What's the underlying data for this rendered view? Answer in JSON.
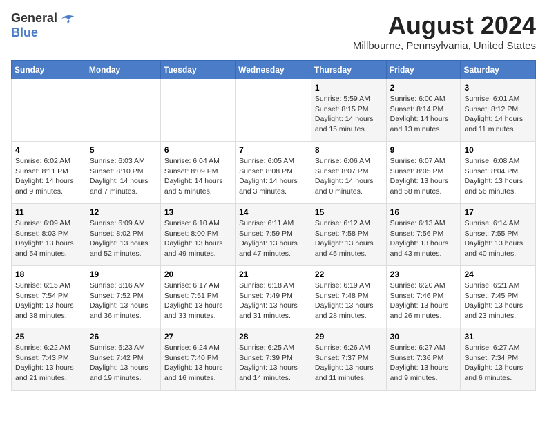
{
  "logo": {
    "line1": "General",
    "line2": "Blue"
  },
  "title": "August 2024",
  "location": "Millbourne, Pennsylvania, United States",
  "headers": [
    "Sunday",
    "Monday",
    "Tuesday",
    "Wednesday",
    "Thursday",
    "Friday",
    "Saturday"
  ],
  "weeks": [
    [
      {
        "day": "",
        "sunrise": "",
        "sunset": "",
        "daylight": ""
      },
      {
        "day": "",
        "sunrise": "",
        "sunset": "",
        "daylight": ""
      },
      {
        "day": "",
        "sunrise": "",
        "sunset": "",
        "daylight": ""
      },
      {
        "day": "",
        "sunrise": "",
        "sunset": "",
        "daylight": ""
      },
      {
        "day": "1",
        "sunrise": "Sunrise: 5:59 AM",
        "sunset": "Sunset: 8:15 PM",
        "daylight": "Daylight: 14 hours and 15 minutes."
      },
      {
        "day": "2",
        "sunrise": "Sunrise: 6:00 AM",
        "sunset": "Sunset: 8:14 PM",
        "daylight": "Daylight: 14 hours and 13 minutes."
      },
      {
        "day": "3",
        "sunrise": "Sunrise: 6:01 AM",
        "sunset": "Sunset: 8:12 PM",
        "daylight": "Daylight: 14 hours and 11 minutes."
      }
    ],
    [
      {
        "day": "4",
        "sunrise": "Sunrise: 6:02 AM",
        "sunset": "Sunset: 8:11 PM",
        "daylight": "Daylight: 14 hours and 9 minutes."
      },
      {
        "day": "5",
        "sunrise": "Sunrise: 6:03 AM",
        "sunset": "Sunset: 8:10 PM",
        "daylight": "Daylight: 14 hours and 7 minutes."
      },
      {
        "day": "6",
        "sunrise": "Sunrise: 6:04 AM",
        "sunset": "Sunset: 8:09 PM",
        "daylight": "Daylight: 14 hours and 5 minutes."
      },
      {
        "day": "7",
        "sunrise": "Sunrise: 6:05 AM",
        "sunset": "Sunset: 8:08 PM",
        "daylight": "Daylight: 14 hours and 3 minutes."
      },
      {
        "day": "8",
        "sunrise": "Sunrise: 6:06 AM",
        "sunset": "Sunset: 8:07 PM",
        "daylight": "Daylight: 14 hours and 0 minutes."
      },
      {
        "day": "9",
        "sunrise": "Sunrise: 6:07 AM",
        "sunset": "Sunset: 8:05 PM",
        "daylight": "Daylight: 13 hours and 58 minutes."
      },
      {
        "day": "10",
        "sunrise": "Sunrise: 6:08 AM",
        "sunset": "Sunset: 8:04 PM",
        "daylight": "Daylight: 13 hours and 56 minutes."
      }
    ],
    [
      {
        "day": "11",
        "sunrise": "Sunrise: 6:09 AM",
        "sunset": "Sunset: 8:03 PM",
        "daylight": "Daylight: 13 hours and 54 minutes."
      },
      {
        "day": "12",
        "sunrise": "Sunrise: 6:09 AM",
        "sunset": "Sunset: 8:02 PM",
        "daylight": "Daylight: 13 hours and 52 minutes."
      },
      {
        "day": "13",
        "sunrise": "Sunrise: 6:10 AM",
        "sunset": "Sunset: 8:00 PM",
        "daylight": "Daylight: 13 hours and 49 minutes."
      },
      {
        "day": "14",
        "sunrise": "Sunrise: 6:11 AM",
        "sunset": "Sunset: 7:59 PM",
        "daylight": "Daylight: 13 hours and 47 minutes."
      },
      {
        "day": "15",
        "sunrise": "Sunrise: 6:12 AM",
        "sunset": "Sunset: 7:58 PM",
        "daylight": "Daylight: 13 hours and 45 minutes."
      },
      {
        "day": "16",
        "sunrise": "Sunrise: 6:13 AM",
        "sunset": "Sunset: 7:56 PM",
        "daylight": "Daylight: 13 hours and 43 minutes."
      },
      {
        "day": "17",
        "sunrise": "Sunrise: 6:14 AM",
        "sunset": "Sunset: 7:55 PM",
        "daylight": "Daylight: 13 hours and 40 minutes."
      }
    ],
    [
      {
        "day": "18",
        "sunrise": "Sunrise: 6:15 AM",
        "sunset": "Sunset: 7:54 PM",
        "daylight": "Daylight: 13 hours and 38 minutes."
      },
      {
        "day": "19",
        "sunrise": "Sunrise: 6:16 AM",
        "sunset": "Sunset: 7:52 PM",
        "daylight": "Daylight: 13 hours and 36 minutes."
      },
      {
        "day": "20",
        "sunrise": "Sunrise: 6:17 AM",
        "sunset": "Sunset: 7:51 PM",
        "daylight": "Daylight: 13 hours and 33 minutes."
      },
      {
        "day": "21",
        "sunrise": "Sunrise: 6:18 AM",
        "sunset": "Sunset: 7:49 PM",
        "daylight": "Daylight: 13 hours and 31 minutes."
      },
      {
        "day": "22",
        "sunrise": "Sunrise: 6:19 AM",
        "sunset": "Sunset: 7:48 PM",
        "daylight": "Daylight: 13 hours and 28 minutes."
      },
      {
        "day": "23",
        "sunrise": "Sunrise: 6:20 AM",
        "sunset": "Sunset: 7:46 PM",
        "daylight": "Daylight: 13 hours and 26 minutes."
      },
      {
        "day": "24",
        "sunrise": "Sunrise: 6:21 AM",
        "sunset": "Sunset: 7:45 PM",
        "daylight": "Daylight: 13 hours and 23 minutes."
      }
    ],
    [
      {
        "day": "25",
        "sunrise": "Sunrise: 6:22 AM",
        "sunset": "Sunset: 7:43 PM",
        "daylight": "Daylight: 13 hours and 21 minutes."
      },
      {
        "day": "26",
        "sunrise": "Sunrise: 6:23 AM",
        "sunset": "Sunset: 7:42 PM",
        "daylight": "Daylight: 13 hours and 19 minutes."
      },
      {
        "day": "27",
        "sunrise": "Sunrise: 6:24 AM",
        "sunset": "Sunset: 7:40 PM",
        "daylight": "Daylight: 13 hours and 16 minutes."
      },
      {
        "day": "28",
        "sunrise": "Sunrise: 6:25 AM",
        "sunset": "Sunset: 7:39 PM",
        "daylight": "Daylight: 13 hours and 14 minutes."
      },
      {
        "day": "29",
        "sunrise": "Sunrise: 6:26 AM",
        "sunset": "Sunset: 7:37 PM",
        "daylight": "Daylight: 13 hours and 11 minutes."
      },
      {
        "day": "30",
        "sunrise": "Sunrise: 6:27 AM",
        "sunset": "Sunset: 7:36 PM",
        "daylight": "Daylight: 13 hours and 9 minutes."
      },
      {
        "day": "31",
        "sunrise": "Sunrise: 6:27 AM",
        "sunset": "Sunset: 7:34 PM",
        "daylight": "Daylight: 13 hours and 6 minutes."
      }
    ]
  ]
}
